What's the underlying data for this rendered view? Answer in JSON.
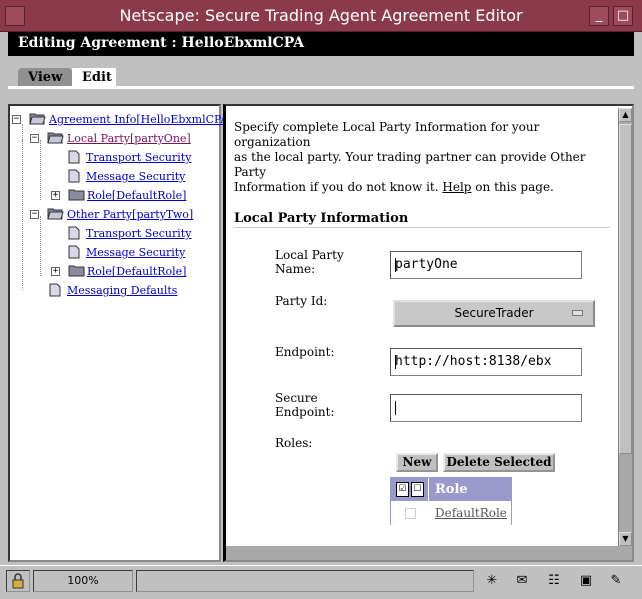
{
  "window": {
    "title": "Netscape: Secure Trading Agent Agreement Editor",
    "minimize_glyph": "_",
    "close_glyph": "□"
  },
  "header": {
    "text": "Editing Agreement : HelloEbxmlCPA"
  },
  "tabs": [
    {
      "label": "View"
    },
    {
      "label": "Edit",
      "active": true
    }
  ],
  "tree": {
    "root": {
      "label": "Agreement Info[HelloEbxmlCPA]"
    },
    "local_party": {
      "label": "Local Party[partyOne]"
    },
    "local_children": [
      {
        "label": "Transport Security"
      },
      {
        "label": "Message Security"
      },
      {
        "label": "Role[DefaultRole]"
      }
    ],
    "other_party": {
      "label": "Other Party[partyTwo]"
    },
    "other_children": [
      {
        "label": "Transport Security"
      },
      {
        "label": "Message Security"
      },
      {
        "label": "Role[DefaultRole]"
      }
    ],
    "messaging_defaults": {
      "label": "Messaging Defaults"
    }
  },
  "content": {
    "intro_line1": "Specify complete Local Party Information for your organization",
    "intro_line2": "as the local party. Your trading partner can provide Other Party",
    "intro_line3_pre": "Information if you do not know it. ",
    "help_link": "Help",
    "intro_line3_post": " on this page.",
    "section_heading": "Local Party Information",
    "fields": {
      "party_name_label_1": "Local Party",
      "party_name_label_2": "Name:",
      "party_name_value": "partyOne",
      "party_id_label": "Party Id:",
      "party_id_value": "SecureTrader",
      "endpoint_label": "Endpoint:",
      "endpoint_value": "http://host:8138/ebx",
      "secure_endpoint_label_1": "Secure",
      "secure_endpoint_label_2": "Endpoint:",
      "secure_endpoint_value": "",
      "roles_label": "Roles:"
    },
    "buttons": {
      "new": "New",
      "delete_selected": "Delete Selected"
    },
    "roles_table": {
      "header": "Role",
      "rows": [
        {
          "role": "DefaultRole"
        }
      ]
    }
  },
  "status": {
    "zoom": "100%",
    "message": ""
  }
}
